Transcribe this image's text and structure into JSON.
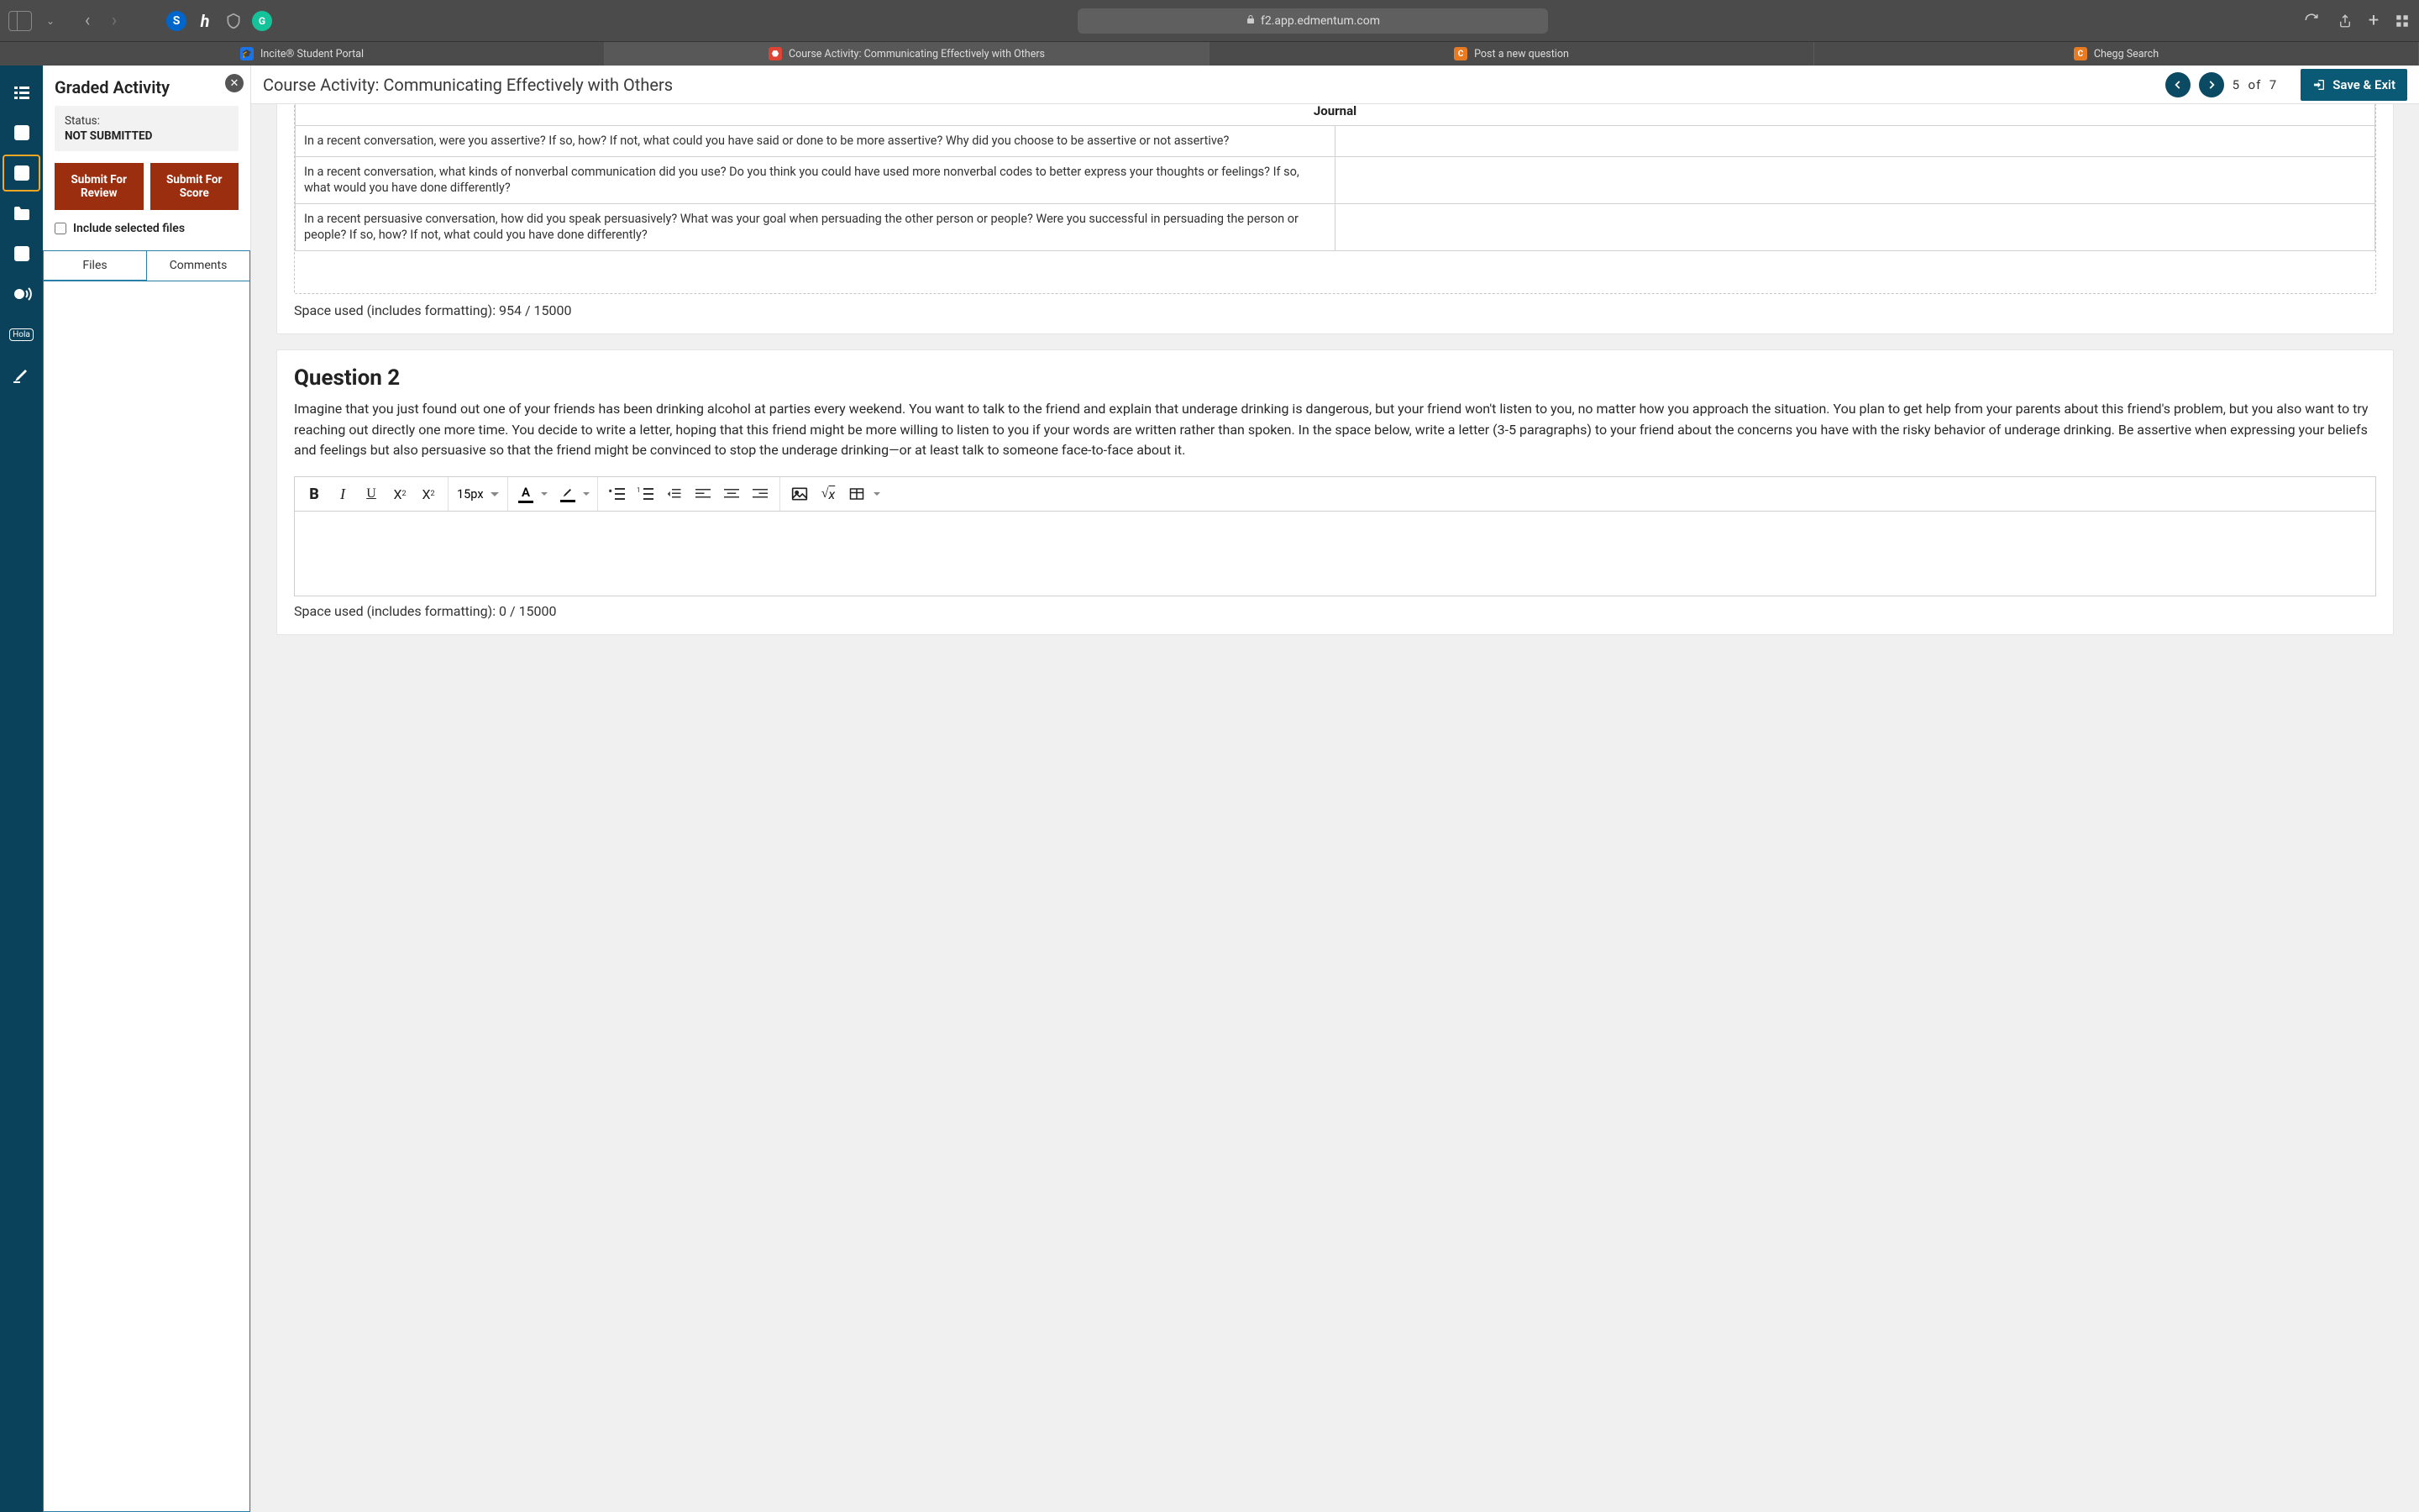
{
  "browser": {
    "url": "f2.app.edmentum.com",
    "tabs": [
      {
        "label": "Incite® Student Portal",
        "icon": "blue"
      },
      {
        "label": "Course Activity: Communicating Effectively with Others",
        "icon": "red"
      },
      {
        "label": "Post a new question",
        "icon": "orange"
      },
      {
        "label": "Chegg Search",
        "icon": "orange"
      }
    ]
  },
  "panel": {
    "title": "Graded Activity",
    "status_label": "Status:",
    "status_value": "NOT SUBMITTED",
    "submit_review": "Submit For Review",
    "submit_score": "Submit For Score",
    "include_files": "Include selected files",
    "tab_files": "Files",
    "tab_comments": "Comments"
  },
  "header": {
    "activity_title": "Course Activity: Communicating Effectively with Others",
    "page_current": "5",
    "page_of": "of",
    "page_total": "7",
    "save_exit": "Save & Exit"
  },
  "journal": {
    "heading": "Journal",
    "rows": [
      "In a recent conversation, were you assertive? If so, how? If not, what could you have said or done to be more assertive? Why did you choose to be assertive or not assertive?",
      "In a recent conversation, what kinds of nonverbal communication did you use? Do you think you could have used more nonverbal codes to better express your thoughts or feelings? If so, what would you have done differently?",
      "In a recent persuasive conversation, how did you speak persuasively? What was your goal when persuading the other person or people? Were you successful in persuading the person or people? If so, how? If not, what could you have done differently?"
    ],
    "space_used": "Space used (includes formatting): 954 / 15000"
  },
  "question2": {
    "title": "Question 2",
    "body": "Imagine that you just found out one of your friends has been drinking alcohol at parties every weekend. You want to talk to the friend and explain that underage drinking is dangerous, but your friend won't listen to you, no matter how you approach the situation. You plan to get help from your parents about this friend's problem, but you also want to try reaching out directly one more time. You decide to write a letter, hoping that this friend might be more willing to listen to you if your words are written rather than spoken. In the space below, write a letter (3-5 paragraphs) to your friend about the concerns you have with the risky behavior of underage drinking. Be assertive when expressing your beliefs and feelings but also persuasive so that the friend might be convinced to stop the underage drinking—or at least talk to someone face-to-face about it.",
    "font_size": "15px",
    "space_used": "Space used (includes formatting): 0 / 15000"
  }
}
